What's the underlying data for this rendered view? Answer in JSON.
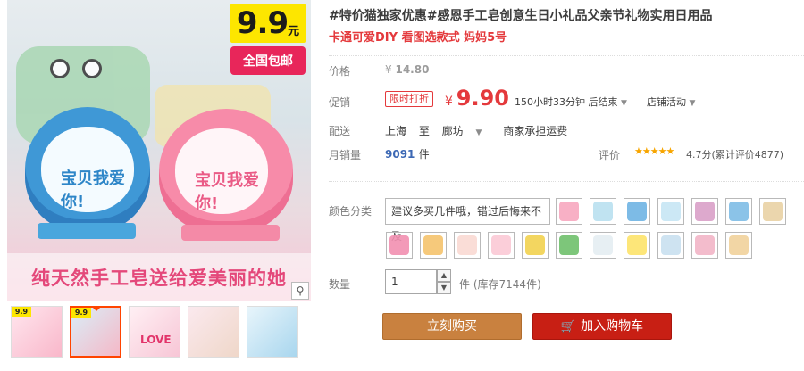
{
  "gallery": {
    "tag_price": "9.9",
    "tag_unit": "元",
    "tag_shipping": "全国包邮",
    "soap_text_blue": "宝贝我爱你!",
    "soap_text_pink": "宝贝我爱你!",
    "slogan": "纯天然手工皂送给爱美丽的她",
    "thumb_tag": "9.9",
    "thumb_love": "LOVE",
    "zoom_icon": "⚲"
  },
  "product": {
    "title": "#特价猫独家优惠#感恩手工皂创意生日小礼品父亲节礼物实用日用品",
    "subtitle": "卡通可爱DIY 看图选款式 妈妈5号"
  },
  "labels": {
    "price": "价格",
    "promo": "促销",
    "shipping": "配送",
    "sales": "月销量",
    "rating": "评价",
    "color": "颜色分类",
    "quantity": "数量"
  },
  "price": {
    "currency": "¥",
    "original": "14.80",
    "promo_badge": "限时打折",
    "promo_value": "9.90",
    "countdown": "150小时33分钟 后结束",
    "shop_activity": "店铺活动"
  },
  "shipping": {
    "from": "上海",
    "to_word": "至",
    "to": "廊坊",
    "fee": "商家承担运费"
  },
  "sales": {
    "count": "9091",
    "unit": "件"
  },
  "rating": {
    "stars": "★★★★★",
    "text": "4.7分(累计评价4877)"
  },
  "sku": {
    "note": "建议多买几件哦，错过后悔来不及"
  },
  "quantity": {
    "value": "1",
    "unit": "件",
    "stock": "(库存7144件)"
  },
  "buttons": {
    "buy": "立刻购买",
    "cart": "加入购物车"
  },
  "colors": {
    "accent_red": "#e4393c",
    "buy_button": "#c9813f",
    "cart_button": "#c81f14",
    "tag_yellow": "#fde600",
    "tag_pink": "#e8265a"
  }
}
